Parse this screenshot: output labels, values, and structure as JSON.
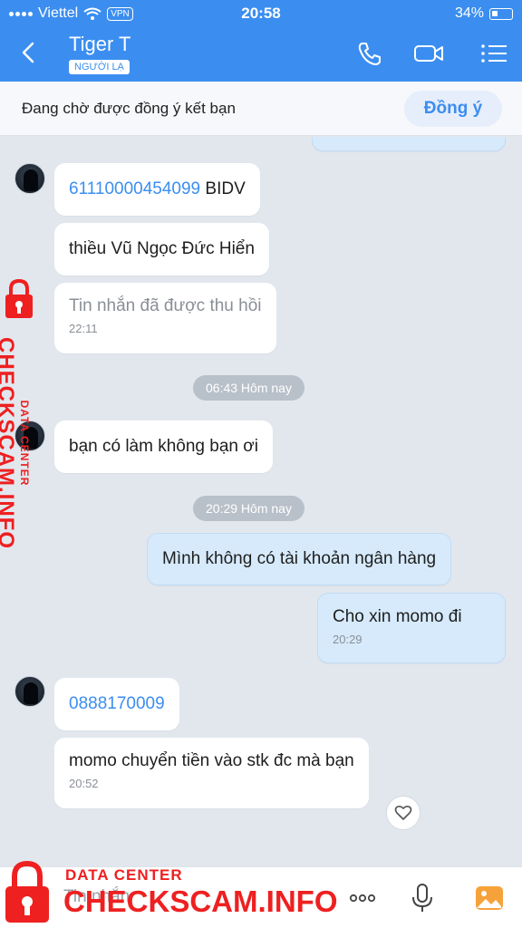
{
  "status_bar": {
    "carrier": "Viettel",
    "vpn": "VPN",
    "time": "20:58",
    "battery": "34%"
  },
  "header": {
    "contact_name": "Tiger T",
    "stranger_badge": "NGƯỜI LẠ"
  },
  "friend_request": {
    "message": "Đang chờ được đồng ý kết bạn",
    "accept_label": "Đồng ý"
  },
  "messages": [
    {
      "text": "61110000454099",
      "suffix": " BIDV"
    },
    {
      "text": "thiều Vũ Ngọc Đức Hiển"
    },
    {
      "text": "Tin nhắn đã được thu hồi",
      "time": "22:11"
    },
    {
      "text": "bạn có làm không bạn ơi"
    },
    {
      "text": "Mình không có tài khoản ngân hàng"
    },
    {
      "text": "Cho xin momo đi",
      "time": "20:29"
    },
    {
      "text": "0888170009"
    },
    {
      "text": "momo chuyển tiền vào stk đc mà bạn",
      "time": "20:52"
    }
  ],
  "timestamps": [
    "06:43 Hôm nay",
    "20:29 Hôm nay"
  ],
  "input": {
    "placeholder": "Tin nhắn"
  },
  "watermark": {
    "line1": "DATA CENTER",
    "line2": "CHECKSCAM.INFO"
  },
  "icons": [
    "back-icon",
    "phone-icon",
    "video-call-icon",
    "menu-icon",
    "wifi-icon",
    "heart-icon",
    "more-icon",
    "microphone-icon",
    "image-icon",
    "lock-icon"
  ],
  "colors": {
    "header": "#3b8ef0",
    "outgoing_bubble": "#d6eafb",
    "link": "#3b8ef0",
    "watermark": "#ee2020"
  }
}
